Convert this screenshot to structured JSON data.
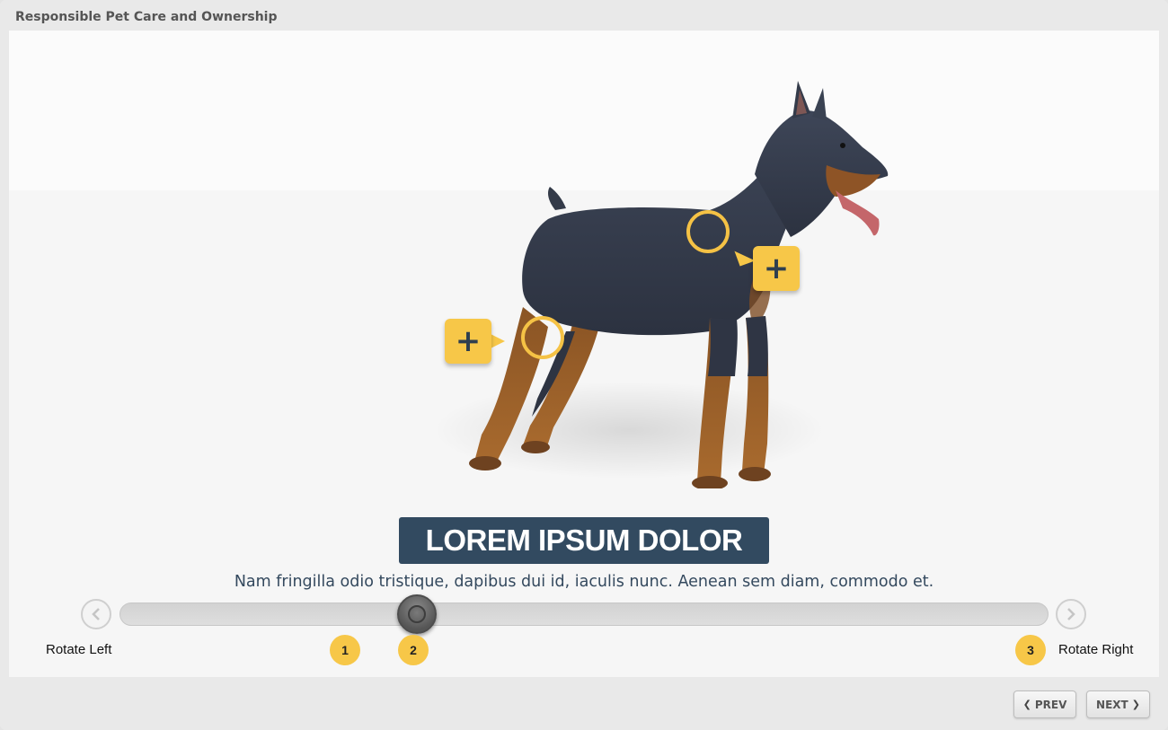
{
  "window": {
    "title": "Responsible Pet Care and Ownership"
  },
  "slide": {
    "image": "doberman-3d-model",
    "headline": "LOREM IPSUM DOLOR",
    "caption": "Nam fringilla odio tristique, dapibus dui id, iaculis nunc. Aenean sem diam, commodo et.",
    "hotspots": [
      {
        "name": "hotspot-shoulder",
        "icon": "plus-icon",
        "glyph": "+"
      },
      {
        "name": "hotspot-hind-leg",
        "icon": "plus-icon",
        "glyph": "+"
      }
    ]
  },
  "rotator": {
    "rotate_left_label": "Rotate Left",
    "rotate_right_label": "Rotate Right",
    "left_icon": "chevron-left-icon",
    "right_icon": "chevron-right-icon",
    "position_fraction": 0.32,
    "markers": [
      "1",
      "2",
      "3"
    ]
  },
  "footer": {
    "prev_label": "PREV",
    "next_label": "NEXT",
    "prev_icon": "chevron-left-icon",
    "next_icon": "chevron-right-icon"
  },
  "colors": {
    "accent": "#f7c748",
    "headline_bg": "#324a60",
    "caption_text": "#34495e"
  }
}
